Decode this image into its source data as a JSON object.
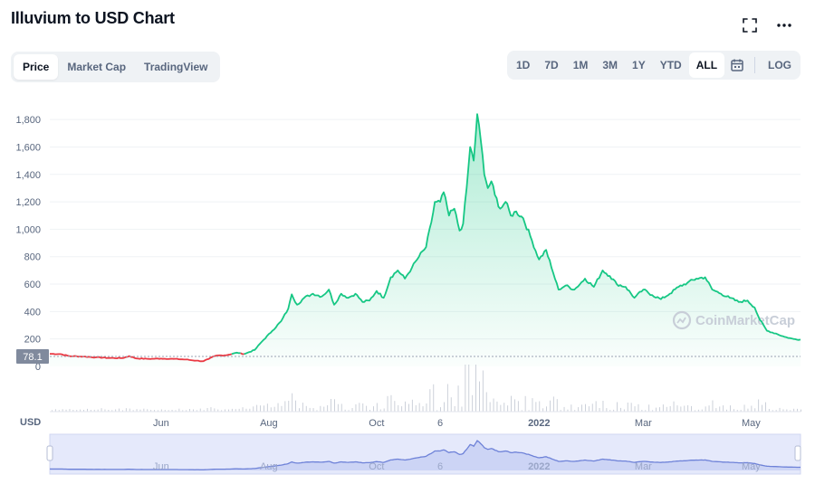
{
  "header": {
    "title": "Illuvium to USD Chart",
    "expand_icon": "expand-icon",
    "more_icon": "more-horizontal-icon"
  },
  "tabs": [
    {
      "label": "Price",
      "active": true
    },
    {
      "label": "Market Cap",
      "active": false
    },
    {
      "label": "TradingView",
      "active": false
    }
  ],
  "ranges": [
    {
      "label": "1D",
      "active": false
    },
    {
      "label": "7D",
      "active": false
    },
    {
      "label": "1M",
      "active": false
    },
    {
      "label": "3M",
      "active": false
    },
    {
      "label": "1Y",
      "active": false
    },
    {
      "label": "YTD",
      "active": false
    },
    {
      "label": "ALL",
      "active": true
    }
  ],
  "calendar_icon": "calendar-icon",
  "log_label": "LOG",
  "watermark": "CoinMarketCap",
  "currency_label": "USD",
  "colors": {
    "up": "#16c784",
    "down": "#ea3943",
    "navigator": "#6e82d8",
    "price_marker": "#808a9d"
  },
  "chart_data": {
    "type": "line",
    "title": "Illuvium to USD Chart",
    "xlabel": "",
    "ylabel": "",
    "ylim": [
      0,
      1900
    ],
    "y_ticks": [
      0,
      200,
      400,
      600,
      800,
      1000,
      1200,
      1400,
      1600,
      1800
    ],
    "y_tick_labels": [
      "0",
      "200",
      "400",
      "600",
      "800",
      "1,000",
      "1,200",
      "1,400",
      "1,600",
      "1,800"
    ],
    "x_range": [
      "2021-03-30",
      "2022-05-29"
    ],
    "x_ticks": [
      {
        "date": "2021-06-01",
        "label": "Jun",
        "bold": false
      },
      {
        "date": "2021-08-01",
        "label": "Aug",
        "bold": false
      },
      {
        "date": "2021-10-01",
        "label": "Oct",
        "bold": false
      },
      {
        "date": "2021-11-06",
        "label": "6",
        "bold": false
      },
      {
        "date": "2022-01-01",
        "label": "2022",
        "bold": true
      },
      {
        "date": "2022-03-01",
        "label": "Mar",
        "bold": false
      },
      {
        "date": "2022-05-01",
        "label": "May",
        "bold": false
      }
    ],
    "current_price_label": "78.1",
    "current_price": 78.1,
    "grid": true,
    "legend": "none",
    "series": [
      {
        "values": [
          [
            "2021-03-30",
            92
          ],
          [
            "2021-04-05",
            90
          ],
          [
            "2021-04-10",
            75
          ],
          [
            "2021-04-18",
            72
          ],
          [
            "2021-04-25",
            66
          ],
          [
            "2021-05-02",
            62
          ],
          [
            "2021-05-10",
            60
          ],
          [
            "2021-05-14",
            75
          ],
          [
            "2021-05-18",
            58
          ],
          [
            "2021-05-25",
            55
          ],
          [
            "2021-06-01",
            57
          ],
          [
            "2021-06-08",
            55
          ],
          [
            "2021-06-15",
            50
          ],
          [
            "2021-06-21",
            42
          ],
          [
            "2021-06-25",
            38
          ],
          [
            "2021-06-28",
            55
          ],
          [
            "2021-07-02",
            78
          ],
          [
            "2021-07-08",
            82
          ],
          [
            "2021-07-14",
            100
          ],
          [
            "2021-07-18",
            90
          ],
          [
            "2021-07-24",
            120
          ],
          [
            "2021-07-28",
            180
          ],
          [
            "2021-08-03",
            260
          ],
          [
            "2021-08-08",
            330
          ],
          [
            "2021-08-12",
            420
          ],
          [
            "2021-08-14",
            525
          ],
          [
            "2021-08-17",
            450
          ],
          [
            "2021-08-21",
            500
          ],
          [
            "2021-08-26",
            530
          ],
          [
            "2021-08-31",
            510
          ],
          [
            "2021-09-04",
            560
          ],
          [
            "2021-09-07",
            450
          ],
          [
            "2021-09-11",
            530
          ],
          [
            "2021-09-15",
            500
          ],
          [
            "2021-09-19",
            530
          ],
          [
            "2021-09-23",
            470
          ],
          [
            "2021-09-27",
            480
          ],
          [
            "2021-10-01",
            550
          ],
          [
            "2021-10-05",
            500
          ],
          [
            "2021-10-09",
            650
          ],
          [
            "2021-10-13",
            700
          ],
          [
            "2021-10-17",
            640
          ],
          [
            "2021-10-21",
            720
          ],
          [
            "2021-10-25",
            800
          ],
          [
            "2021-10-29",
            870
          ],
          [
            "2021-11-01",
            1050
          ],
          [
            "2021-11-03",
            1200
          ],
          [
            "2021-11-06",
            1200
          ],
          [
            "2021-11-08",
            1270
          ],
          [
            "2021-11-11",
            1100
          ],
          [
            "2021-11-14",
            1150
          ],
          [
            "2021-11-17",
            990
          ],
          [
            "2021-11-19",
            1040
          ],
          [
            "2021-11-21",
            1300
          ],
          [
            "2021-11-23",
            1600
          ],
          [
            "2021-11-25",
            1500
          ],
          [
            "2021-11-27",
            1840
          ],
          [
            "2021-11-29",
            1650
          ],
          [
            "2021-12-01",
            1400
          ],
          [
            "2021-12-03",
            1300
          ],
          [
            "2021-12-05",
            1350
          ],
          [
            "2021-12-07",
            1250
          ],
          [
            "2021-12-10",
            1150
          ],
          [
            "2021-12-13",
            1200
          ],
          [
            "2021-12-16",
            1100
          ],
          [
            "2021-12-19",
            1130
          ],
          [
            "2021-12-23",
            1080
          ],
          [
            "2021-12-27",
            950
          ],
          [
            "2022-01-01",
            780
          ],
          [
            "2022-01-05",
            850
          ],
          [
            "2022-01-08",
            720
          ],
          [
            "2022-01-12",
            560
          ],
          [
            "2022-01-16",
            590
          ],
          [
            "2022-01-21",
            560
          ],
          [
            "2022-01-27",
            640
          ],
          [
            "2022-02-01",
            580
          ],
          [
            "2022-02-06",
            700
          ],
          [
            "2022-02-10",
            660
          ],
          [
            "2022-02-14",
            600
          ],
          [
            "2022-02-19",
            580
          ],
          [
            "2022-02-24",
            500
          ],
          [
            "2022-03-01",
            560
          ],
          [
            "2022-03-06",
            520
          ],
          [
            "2022-03-11",
            490
          ],
          [
            "2022-03-16",
            530
          ],
          [
            "2022-03-21",
            580
          ],
          [
            "2022-03-26",
            610
          ],
          [
            "2022-03-31",
            640
          ],
          [
            "2022-04-05",
            650
          ],
          [
            "2022-04-09",
            560
          ],
          [
            "2022-04-14",
            530
          ],
          [
            "2022-04-19",
            500
          ],
          [
            "2022-04-24",
            470
          ],
          [
            "2022-04-29",
            480
          ],
          [
            "2022-05-03",
            430
          ],
          [
            "2022-05-06",
            340
          ],
          [
            "2022-05-10",
            260
          ],
          [
            "2022-05-15",
            240
          ],
          [
            "2022-05-20",
            215
          ],
          [
            "2022-05-25",
            200
          ],
          [
            "2022-05-29",
            195
          ]
        ]
      }
    ]
  }
}
